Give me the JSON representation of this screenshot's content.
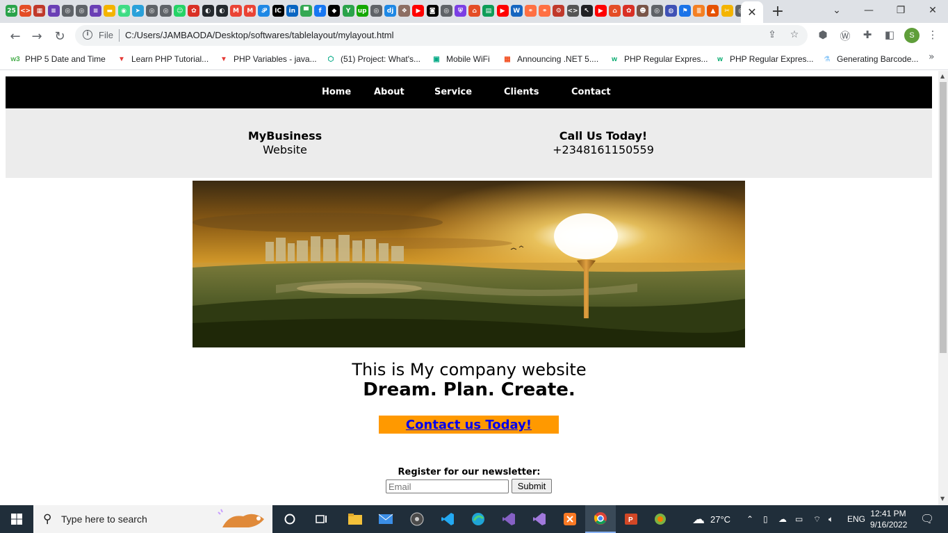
{
  "browser": {
    "tabs_favicons": [
      {
        "icon": "calendar-25-icon",
        "color": "#2aa34a",
        "glyph": "25"
      },
      {
        "icon": "code-icon",
        "color": "#e44d26",
        "glyph": "<>"
      },
      {
        "icon": "table-icon",
        "color": "#c0392b",
        "glyph": "▦"
      },
      {
        "icon": "list-icon",
        "color": "#6a3fb5",
        "glyph": "≡"
      },
      {
        "icon": "globe-icon",
        "color": "#5f6368",
        "glyph": "◎"
      },
      {
        "icon": "globe-icon",
        "color": "#5f6368",
        "glyph": "◎"
      },
      {
        "icon": "list-icon",
        "color": "#6a3fb5",
        "glyph": "≡"
      },
      {
        "icon": "slides-icon",
        "color": "#f4b400",
        "glyph": "▬"
      },
      {
        "icon": "android-icon",
        "color": "#3ddc84",
        "glyph": "◉"
      },
      {
        "icon": "telegram-icon",
        "color": "#2aa1da",
        "glyph": "➤"
      },
      {
        "icon": "globe-icon",
        "color": "#5f6368",
        "glyph": "◎"
      },
      {
        "icon": "globe-icon",
        "color": "#5f6368",
        "glyph": "◎"
      },
      {
        "icon": "chat-icon",
        "color": "#25d366",
        "glyph": "☺"
      },
      {
        "icon": "flower-icon",
        "color": "#d93025",
        "glyph": "✿"
      },
      {
        "icon": "github-icon",
        "color": "#24292e",
        "glyph": "◐"
      },
      {
        "icon": "github-icon",
        "color": "#24292e",
        "glyph": "◐"
      },
      {
        "icon": "gmail-icon",
        "color": "#ea4335",
        "glyph": "M"
      },
      {
        "icon": "gmail-icon",
        "color": "#ea4335",
        "glyph": "M"
      },
      {
        "icon": "figma-icon",
        "color": "#1e88e5",
        "glyph": "𝒫"
      },
      {
        "icon": "intellij-icon",
        "color": "#000000",
        "glyph": "IC"
      },
      {
        "icon": "linkedin-icon",
        "color": "#0a66c2",
        "glyph": "in"
      },
      {
        "icon": "pin-icon",
        "color": "#34a853",
        "glyph": "▀"
      },
      {
        "icon": "facebook-icon",
        "color": "#1877f2",
        "glyph": "f"
      },
      {
        "icon": "tiktok-icon",
        "color": "#000000",
        "glyph": "◆"
      },
      {
        "icon": "y-icon",
        "color": "#2aa34a",
        "glyph": "Y"
      },
      {
        "icon": "upwork-icon",
        "color": "#14a800",
        "glyph": "up"
      },
      {
        "icon": "globe-icon",
        "color": "#5f6368",
        "glyph": "◎"
      },
      {
        "icon": "dj-icon",
        "color": "#1e88e5",
        "glyph": "dj"
      },
      {
        "icon": "emblem-icon",
        "color": "#8d6e63",
        "glyph": "❖"
      },
      {
        "icon": "youtube-icon",
        "color": "#ff0000",
        "glyph": "▶"
      },
      {
        "icon": "camera-icon",
        "color": "#000000",
        "glyph": "◙"
      },
      {
        "icon": "globe-icon",
        "color": "#5f6368",
        "glyph": "◎"
      },
      {
        "icon": "shield-icon",
        "color": "#7b3fe4",
        "glyph": "⛨"
      },
      {
        "icon": "html-icon",
        "color": "#e44d26",
        "glyph": "⌂"
      },
      {
        "icon": "sheet-icon",
        "color": "#0f9d58",
        "glyph": "▤"
      },
      {
        "icon": "youtube-icon",
        "color": "#ff0000",
        "glyph": "▶"
      },
      {
        "icon": "wish-icon",
        "color": "#1565c0",
        "glyph": "W"
      },
      {
        "icon": "link-icon",
        "color": "#ff7043",
        "glyph": "⚭"
      },
      {
        "icon": "link-icon",
        "color": "#ff7043",
        "glyph": "⚭"
      },
      {
        "icon": "gear-icon",
        "color": "#c0392b",
        "glyph": "⚙"
      },
      {
        "icon": "code-icon",
        "color": "#555555",
        "glyph": "<>"
      },
      {
        "icon": "cursor-icon",
        "color": "#202124",
        "glyph": "↖"
      },
      {
        "icon": "youtube-icon",
        "color": "#ff0000",
        "glyph": "▶"
      },
      {
        "icon": "html-icon",
        "color": "#e44d26",
        "glyph": "⌂"
      },
      {
        "icon": "flower-icon",
        "color": "#d93025",
        "glyph": "✿"
      },
      {
        "icon": "avatar-icon",
        "color": "#795548",
        "glyph": "☻"
      },
      {
        "icon": "globe-icon",
        "color": "#5f6368",
        "glyph": "◎"
      },
      {
        "icon": "planet-icon",
        "color": "#3f51b5",
        "glyph": "◍"
      },
      {
        "icon": "flag-icon",
        "color": "#1a73e8",
        "glyph": "⚑"
      },
      {
        "icon": "stack-icon",
        "color": "#f48024",
        "glyph": "≣"
      },
      {
        "icon": "matlab-icon",
        "color": "#e65100",
        "glyph": "▲"
      },
      {
        "icon": "scissors-icon",
        "color": "#f4b400",
        "glyph": "✂"
      },
      {
        "icon": "globe-icon",
        "color": "#5f6368",
        "glyph": "◎"
      }
    ],
    "active_tab_close": "✕",
    "new_tab": "+",
    "address": {
      "scheme_label": "File",
      "url": "C:/Users/JAMBAODA/Desktop/softwares/tablelayout/mylayout.html"
    },
    "profile_initial": "S",
    "bookmarks": [
      {
        "label": "PHP 5 Date and Time",
        "icon": "w3-icon",
        "color": "#4caf50",
        "glyph": "w3"
      },
      {
        "label": "Learn PHP Tutorial...",
        "icon": "tutorial-icon",
        "color": "#e53935",
        "glyph": "▼"
      },
      {
        "label": "PHP Variables - java...",
        "icon": "tutorial-icon",
        "color": "#e53935",
        "glyph": "▼"
      },
      {
        "label": "(51) Project: What's...",
        "icon": "hex-icon",
        "color": "#00a884",
        "glyph": "⬡"
      },
      {
        "label": "Mobile WiFi",
        "icon": "router-icon",
        "color": "#00a884",
        "glyph": "▣"
      },
      {
        "label": "Announcing .NET 5....",
        "icon": "microsoft-icon",
        "color": "#f25022",
        "glyph": "▦"
      },
      {
        "label": "PHP Regular Expres...",
        "icon": "w3-icon",
        "color": "#04aa6d",
        "glyph": "w"
      },
      {
        "label": "PHP Regular Expres...",
        "icon": "w3-icon",
        "color": "#04aa6d",
        "glyph": "w"
      },
      {
        "label": "Generating Barcode...",
        "icon": "flask-icon",
        "color": "#90caf9",
        "glyph": "⚗"
      }
    ],
    "bookmarks_more": "»"
  },
  "page": {
    "nav": [
      {
        "label": "Home"
      },
      {
        "label": "About"
      },
      {
        "label": "Service"
      },
      {
        "label": "Clients"
      },
      {
        "label": "Contact"
      }
    ],
    "brand": {
      "title": "MyBusiness",
      "subtitle": "Website"
    },
    "call": {
      "title": "Call Us Today!",
      "phone": "+2348161150559"
    },
    "tagline": "This is My company website",
    "motto": "Dream. Plan. Create.",
    "cta": "Contact us Today!",
    "newsletter": {
      "label": "Register for our newsletter:",
      "placeholder": "Email",
      "submit": "Submit"
    }
  },
  "taskbar": {
    "search_placeholder": "Type here to search",
    "weather": "27°C",
    "language": "ENG",
    "time": "12:41 PM",
    "date": "9/16/2022"
  },
  "colors": {
    "navbar": "#000000",
    "header_band": "#ececec",
    "cta_background": "#ff9900",
    "cta_link": "#0000ee",
    "taskbar": "#202e3a"
  }
}
